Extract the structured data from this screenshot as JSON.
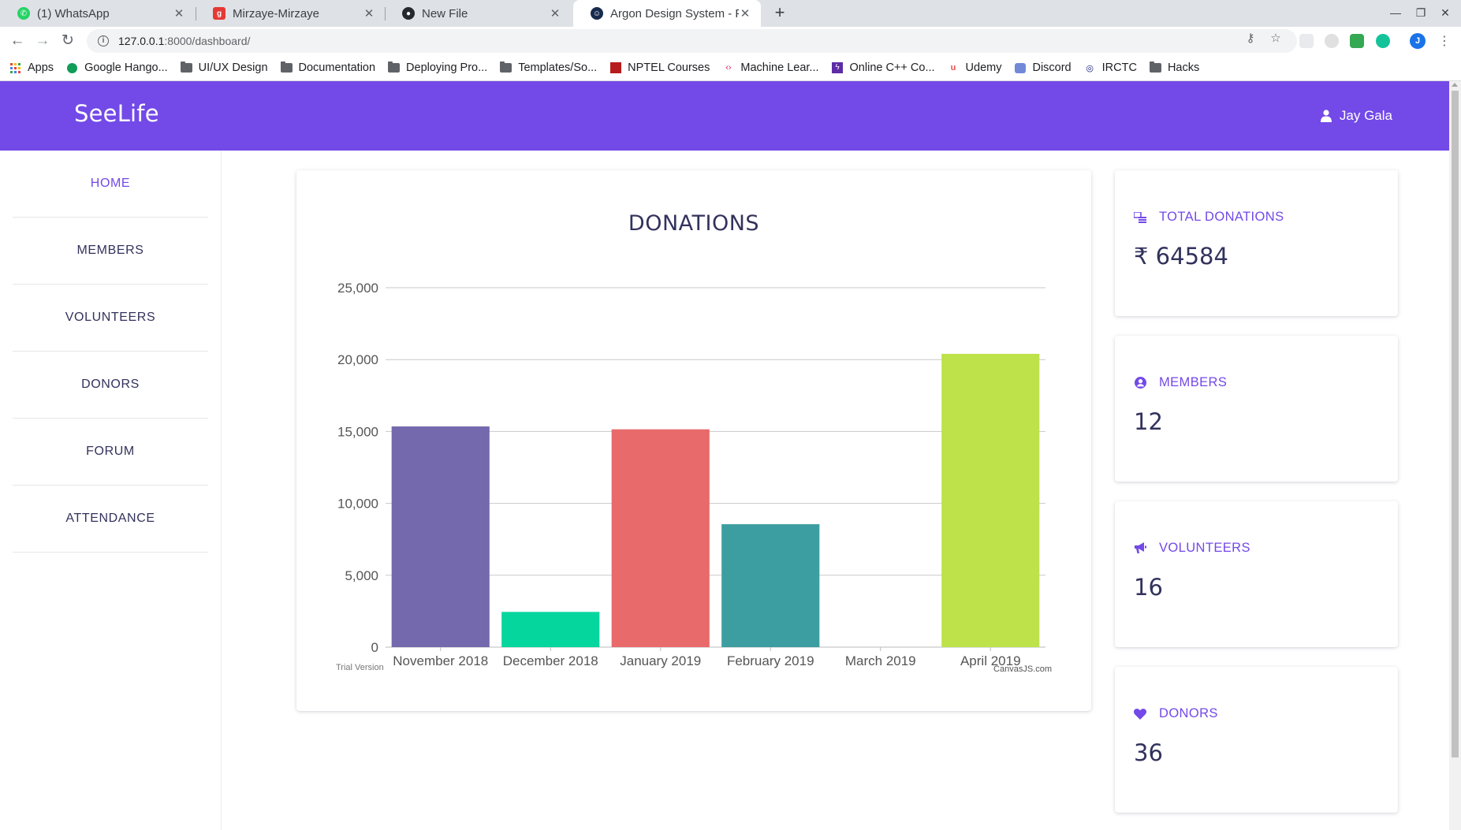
{
  "browser": {
    "tabs": [
      {
        "title": "(1) WhatsApp",
        "icon": "whatsapp-icon",
        "color": "#25d366"
      },
      {
        "title": "Mirzaye-Mirzaye",
        "icon": "g-icon",
        "color": "#e53935"
      },
      {
        "title": "New File",
        "icon": "github-icon",
        "color": "#24292e"
      },
      {
        "title": "Argon Design System - Fre",
        "icon": "argon-icon",
        "color": "#172b4d"
      }
    ],
    "url_host": "127.0.0.1",
    "url_rest": ":8000/dashboard/",
    "profile_initial": "J",
    "bookmarks": [
      {
        "label": "Apps",
        "icon": "apps-icon"
      },
      {
        "label": "Google Hango...",
        "icon": "hangouts-icon"
      },
      {
        "label": "UI/UX Design",
        "icon": "folder-icon"
      },
      {
        "label": "Documentation",
        "icon": "folder-icon"
      },
      {
        "label": "Deploying Pro...",
        "icon": "folder-icon"
      },
      {
        "label": "Templates/So...",
        "icon": "folder-icon"
      },
      {
        "label": "NPTEL Courses",
        "icon": "nptel-icon"
      },
      {
        "label": "Machine Lear...",
        "icon": "code-icon"
      },
      {
        "label": "Online C++ Co...",
        "icon": "bolt-icon"
      },
      {
        "label": "Udemy",
        "icon": "udemy-icon"
      },
      {
        "label": "Discord",
        "icon": "discord-icon"
      },
      {
        "label": "IRCTC",
        "icon": "irctc-icon"
      },
      {
        "label": "Hacks",
        "icon": "folder-icon"
      }
    ]
  },
  "app": {
    "brand": "SeeLife",
    "user_name": "Jay Gala",
    "accent": "#7349e8",
    "sidebar": [
      {
        "label": "HOME",
        "active": true
      },
      {
        "label": "MEMBERS",
        "active": false
      },
      {
        "label": "VOLUNTEERS",
        "active": false
      },
      {
        "label": "DONORS",
        "active": false
      },
      {
        "label": "FORUM",
        "active": false
      },
      {
        "label": "ATTENDANCE",
        "active": false
      }
    ],
    "stats": [
      {
        "label": "TOTAL DONATIONS",
        "value": "₹ 64584",
        "icon": "donations-icon"
      },
      {
        "label": "MEMBERS",
        "value": "12",
        "icon": "user-circle-icon"
      },
      {
        "label": "VOLUNTEERS",
        "value": "16",
        "icon": "megaphone-icon"
      },
      {
        "label": "DONORS",
        "value": "36",
        "icon": "heart-icon"
      }
    ],
    "chart_footer": {
      "trial": "Trial Version",
      "credit": "CanvasJS.com"
    }
  },
  "chart_data": {
    "type": "bar",
    "title": "DONATIONS",
    "categories": [
      "November 2018",
      "December 2018",
      "January 2019",
      "February 2019",
      "March 2019",
      "April 2019"
    ],
    "values": [
      15350,
      2450,
      15150,
      8550,
      0,
      20400
    ],
    "colors": [
      "#7469ad",
      "#05d69e",
      "#e86a6b",
      "#3c9ea1",
      "#cccccc",
      "#bde24a"
    ],
    "ylim": [
      0,
      25000
    ],
    "yticks": [
      0,
      5000,
      10000,
      15000,
      20000,
      25000
    ],
    "ytick_labels": [
      "0",
      "5,000",
      "10,000",
      "15,000",
      "20,000",
      "25,000"
    ],
    "grid": true,
    "xlabel": "",
    "ylabel": ""
  }
}
